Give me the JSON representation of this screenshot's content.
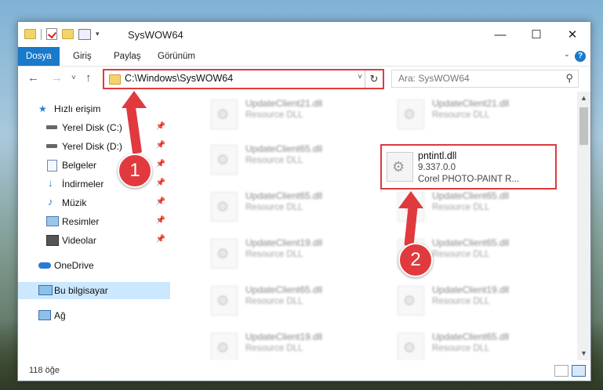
{
  "window": {
    "title": "SysWOW64"
  },
  "title_controls": {
    "minimize": "—",
    "maximize": "☐",
    "close": "✕"
  },
  "ribbon": {
    "tabs": [
      "Dosya",
      "Giriş",
      "Paylaş",
      "Görünüm"
    ],
    "expand_icon": "chevron-down-icon",
    "help": "?"
  },
  "nav": {
    "back": "←",
    "forward": "→",
    "recent": "˅",
    "up": "↑",
    "address": "C:\\Windows\\SysWOW64",
    "dropdown": "˅",
    "refresh": "↻",
    "search_placeholder": "Ara: SysWOW64",
    "search_icon": "⚲"
  },
  "sidebar": {
    "items": [
      {
        "label": "Hızlı erişim",
        "icon": "star-icon",
        "pinned": false
      },
      {
        "label": "Yerel Disk (C:)",
        "icon": "drive-icon",
        "pinned": true
      },
      {
        "label": "Yerel Disk (D:)",
        "icon": "drive-icon",
        "pinned": true
      },
      {
        "label": "Belgeler",
        "icon": "documents-icon",
        "pinned": true
      },
      {
        "label": "İndirmeler",
        "icon": "download-icon",
        "pinned": true
      },
      {
        "label": "Müzik",
        "icon": "music-icon",
        "pinned": true
      },
      {
        "label": "Resimler",
        "icon": "pictures-icon",
        "pinned": true
      },
      {
        "label": "Videolar",
        "icon": "videos-icon",
        "pinned": true
      },
      {
        "label": "OneDrive",
        "icon": "cloud-icon",
        "pinned": false
      },
      {
        "label": "Bu bilgisayar",
        "icon": "computer-icon",
        "pinned": false
      },
      {
        "label": "Ağ",
        "icon": "network-icon",
        "pinned": false
      }
    ],
    "pin_glyph": "📌"
  },
  "files": [
    {
      "name": "UpdateClient21.dll",
      "sub": "Resource DLL"
    },
    {
      "name": "UpdateClient21.dll",
      "sub": "Resource DLL"
    },
    {
      "name": "UpdateClient65.dll",
      "sub": "Resource DLL"
    },
    {
      "name": "UpdateClient65.dll",
      "sub": "Resource DLL"
    },
    {
      "name": "UpdateClient65.dll",
      "sub": "Resource DLL"
    },
    {
      "name": "UpdateClient19.dll",
      "sub": "Resource DLL"
    },
    {
      "name": "UpdateClient65.dll",
      "sub": "Resource DLL"
    },
    {
      "name": "UpdateClient65.dll",
      "sub": "Resource DLL"
    },
    {
      "name": "UpdateClient19.dll",
      "sub": "Resource DLL"
    },
    {
      "name": "UpdateClient19.dll",
      "sub": "Resource DLL"
    },
    {
      "name": "UpdateClient65.dll",
      "sub": "Resource DLL"
    }
  ],
  "highlighted_file": {
    "name": "pntintl.dll",
    "version": "9.337.0.0",
    "company": "Corel PHOTO-PAINT R..."
  },
  "status": {
    "count": "118 öğe"
  },
  "callouts": {
    "one": "1",
    "two": "2"
  },
  "colors": {
    "accent": "#1979ca",
    "highlight": "#e0393e",
    "selected": "#cce8ff"
  }
}
